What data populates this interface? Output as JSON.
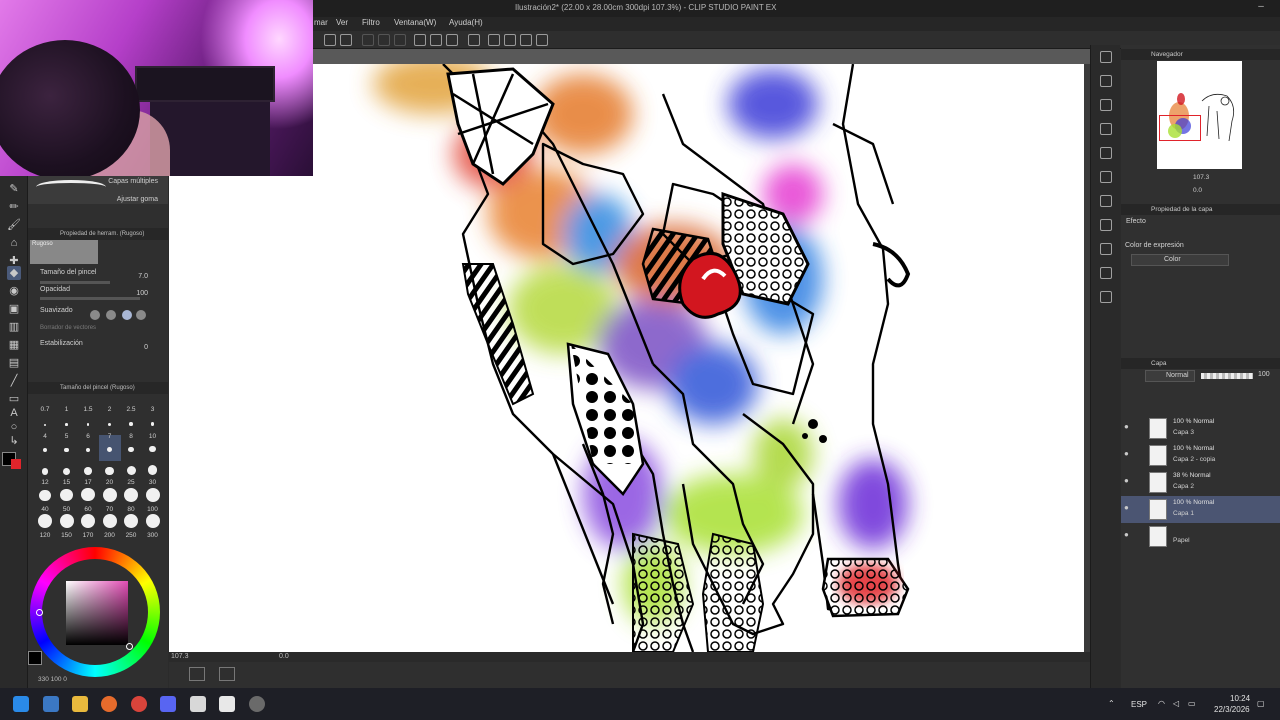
{
  "window": {
    "title": "Ilustración2* (22.00 x 28.00cm 300dpi 107.3%) - CLIP STUDIO PAINT EX",
    "controls": [
      "–",
      "□",
      "✕"
    ]
  },
  "menu": [
    "mar",
    "Ver",
    "Filtro",
    "Ventana(W)",
    "Ayuda(H)"
  ],
  "subtool": {
    "brush_name_1": "Capas múltiples",
    "brush_name_2": "Ajustar goma",
    "panel_title": "Propiedad de herram. (Rugoso)",
    "tool_preview_label": "Rugoso",
    "props": [
      {
        "label": "Tamaño del pincel",
        "value": "7.0"
      },
      {
        "label": "Opacidad",
        "value": "100"
      },
      {
        "label": "Suavizado",
        "value": ""
      },
      {
        "label": "Borrador de vectores",
        "value": ""
      },
      {
        "label": "Estabilización",
        "value": "0"
      }
    ],
    "brush_size_panel_title": "Tamaño del pincel (Rugoso)",
    "sizes": [
      "0.7",
      "1",
      "1.5",
      "2",
      "2.5",
      "3",
      "4",
      "5",
      "6",
      "7",
      "8",
      "10",
      "12",
      "15",
      "17",
      "20",
      "25",
      "30",
      "40",
      "50",
      "60",
      "70",
      "80",
      "100",
      "120",
      "150",
      "170",
      "200",
      "250",
      "300"
    ],
    "active_size": "7"
  },
  "color": {
    "main": "#000000",
    "sub": "#e0242b",
    "hsv_readout": "330 100 0"
  },
  "canvas": {
    "zoom": "107.3",
    "rotation": "0.0"
  },
  "navigator": {
    "title": "Navegador",
    "zoom": "107.3",
    "rotation": "0.0"
  },
  "layer_property": {
    "title": "Propiedad de la capa",
    "effect_label": "Efecto",
    "expression_color_label": "Color de expresión",
    "expression_color_value": "Color"
  },
  "layers": {
    "title": "Capa",
    "blend_mode": "Normal",
    "opacity": "100",
    "items": [
      {
        "mode": "100 % Normal",
        "name": "Capa 3",
        "selected": false
      },
      {
        "mode": "100 % Normal",
        "name": "Capa 2 - copia",
        "selected": false
      },
      {
        "mode": "38 % Normal",
        "name": "Capa 2",
        "selected": false
      },
      {
        "mode": "100 % Normal",
        "name": "Capa 1",
        "selected": true
      },
      {
        "mode": "",
        "name": "Papel",
        "selected": false
      }
    ]
  },
  "taskbar": {
    "language": "ESP",
    "time": "10:24",
    "date": "22/3/2026"
  }
}
